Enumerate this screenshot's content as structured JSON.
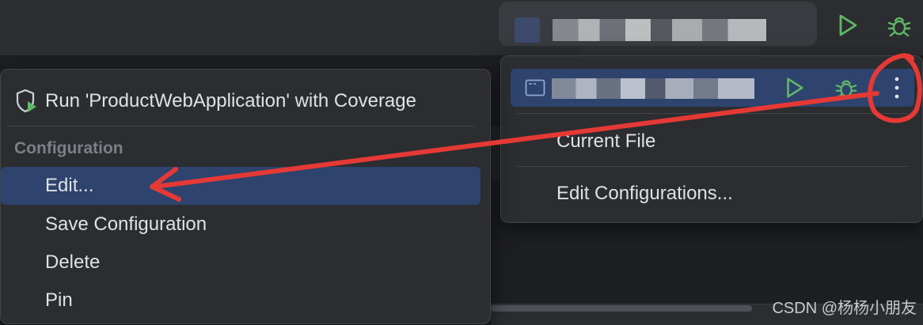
{
  "toolbar": {
    "run_config_selector": {
      "name_redacted": true
    },
    "run_button_icon": "play-icon",
    "debug_button_icon": "bug-icon"
  },
  "context_menu": {
    "coverage_item": {
      "icon": "shield-run-icon",
      "label": "Run 'ProductWebApplication' with Coverage"
    },
    "section_title": "Configuration",
    "items": [
      {
        "label": "Edit...",
        "selected": true
      },
      {
        "label": "Save Configuration",
        "selected": false
      },
      {
        "label": "Delete",
        "selected": false
      },
      {
        "label": "Pin",
        "selected": false
      }
    ]
  },
  "run_config_popup": {
    "selected_config": {
      "name_redacted": true,
      "icon": "window-icon"
    },
    "items": [
      {
        "label": "Current File"
      },
      {
        "label": "Edit Configurations..."
      }
    ],
    "more_icon": "more-vertical-icon"
  },
  "colors": {
    "run_green": "#5fb865",
    "selection_blue": "#2e436e",
    "annotation_red": "#e53935",
    "popup_bg": "#2b2d30"
  },
  "watermark": "CSDN @杨杨小朋友"
}
